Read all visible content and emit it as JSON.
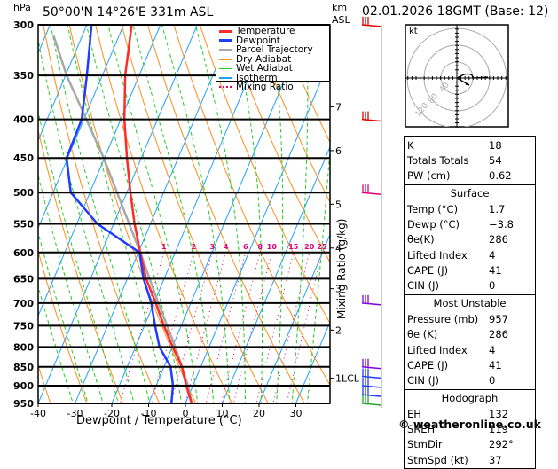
{
  "header": {
    "location": "50°00'N  14°26'E  331m  ASL",
    "datetime": "02.01.2026  18GMT  (Base: 12)",
    "hpa_label": "hPa",
    "km_label": "km",
    "asl_label": "ASL"
  },
  "legend": [
    {
      "label": "Temperature",
      "color": "#ff2a2a"
    },
    {
      "label": "Dewpoint",
      "color": "#1f3cff"
    },
    {
      "label": "Parcel Trajectory",
      "color": "#a8a8a8"
    },
    {
      "label": "Dry Adiabat",
      "color": "#ff8c1a"
    },
    {
      "label": "Wet Adiabat",
      "color": "#22cc22"
    },
    {
      "label": "Isotherm",
      "color": "#1ea0ff"
    },
    {
      "label": "Mixing Ratio",
      "color": "#e0007a"
    }
  ],
  "chart_data": {
    "type": "skew-t log-p",
    "xlabel": "Dewpoint / Temperature (°C)",
    "ylabel": "hPa",
    "y2label": "Mixing Ratio (g/kg)",
    "pressure_ticks": [
      300,
      350,
      400,
      450,
      500,
      550,
      600,
      650,
      700,
      750,
      800,
      850,
      900,
      950
    ],
    "temperature_ticks": [
      -40,
      -30,
      -20,
      -10,
      0,
      10,
      20,
      30
    ],
    "xlim": [
      -40,
      40
    ],
    "ylim": [
      950,
      300
    ],
    "km_ticks": [
      {
        "label": "7",
        "p": 385
      },
      {
        "label": "6",
        "p": 440
      },
      {
        "label": "5",
        "p": 518
      },
      {
        "label": "4",
        "p": 592
      },
      {
        "label": "3",
        "p": 670
      },
      {
        "label": "2",
        "p": 760
      },
      {
        "label": "1LCL",
        "p": 880
      }
    ],
    "mixing_ratio_labels": [
      "1",
      "2",
      "3",
      "4",
      "6",
      "8",
      "10",
      "15",
      "20",
      "25"
    ],
    "mixing_ratio_values": [
      1,
      2,
      3,
      4,
      6,
      8,
      10,
      15,
      20,
      25
    ],
    "temperature": {
      "p": [
        300,
        350,
        400,
        450,
        500,
        550,
        600,
        650,
        700,
        750,
        800,
        850,
        900,
        950
      ],
      "t": [
        -57.8,
        -53.8,
        -49,
        -43.9,
        -39,
        -34.3,
        -29.5,
        -24.9,
        -19.5,
        -14.7,
        -9.9,
        -5.1,
        -1.8,
        1.7
      ]
    },
    "dewpoint": {
      "p": [
        300,
        350,
        400,
        450,
        500,
        550,
        600,
        650,
        700,
        750,
        800,
        850,
        900,
        950
      ],
      "t": [
        -68.7,
        -64.2,
        -60.6,
        -60.3,
        -55.2,
        -44.4,
        -29.7,
        -25.6,
        -20.7,
        -17.1,
        -13.5,
        -8.2,
        -5.4,
        -3.8
      ]
    },
    "parcel": {
      "p": [
        310,
        350,
        450,
        600,
        700,
        800,
        900,
        950
      ],
      "t": [
        -77.8,
        -69.7,
        -50.2,
        -29.5,
        -18.8,
        -9.2,
        -1.3,
        1.7
      ]
    },
    "wind_barbs": [
      {
        "p": 300,
        "color": "#e00000"
      },
      {
        "p": 400,
        "color": "#e00000"
      },
      {
        "p": 500,
        "color": "#e0007a"
      },
      {
        "p": 700,
        "color": "#8000e0"
      },
      {
        "p": 850,
        "color": "#8000e0"
      },
      {
        "p": 875,
        "color": "#1f3cff"
      },
      {
        "p": 900,
        "color": "#1f3cff"
      },
      {
        "p": 925,
        "color": "#1f3cff"
      },
      {
        "p": 950,
        "color": "#22aa22"
      }
    ],
    "hodograph": {
      "unit_label": "kt",
      "ring_labels": [
        "40",
        "80",
        "120"
      ]
    }
  },
  "table": {
    "indices": [
      {
        "k": "K",
        "v": "18"
      },
      {
        "k": "Totals Totals",
        "v": "54"
      },
      {
        "k": "PW (cm)",
        "v": "0.62"
      }
    ],
    "surface": {
      "title": "Surface",
      "rows": [
        {
          "k": "Temp (°C)",
          "v": "1.7"
        },
        {
          "k": "Dewp (°C)",
          "v": "−3.8"
        },
        {
          "k": "θe(K)",
          "v": "286"
        },
        {
          "k": "Lifted Index",
          "v": "4"
        },
        {
          "k": "CAPE (J)",
          "v": "41"
        },
        {
          "k": "CIN (J)",
          "v": "0"
        }
      ]
    },
    "most_unstable": {
      "title": "Most Unstable",
      "rows": [
        {
          "k": "Pressure (mb)",
          "v": "957"
        },
        {
          "k": "θe (K)",
          "v": "286"
        },
        {
          "k": "Lifted Index",
          "v": "4"
        },
        {
          "k": "CAPE (J)",
          "v": "41"
        },
        {
          "k": "CIN (J)",
          "v": "0"
        }
      ]
    },
    "hodograph": {
      "title": "Hodograph",
      "rows": [
        {
          "k": "EH",
          "v": "132"
        },
        {
          "k": "SREH",
          "v": "119"
        },
        {
          "k": "StmDir",
          "v": "292°"
        },
        {
          "k": "StmSpd (kt)",
          "v": "37"
        }
      ]
    }
  },
  "copyright": "© weatheronline.co.uk"
}
